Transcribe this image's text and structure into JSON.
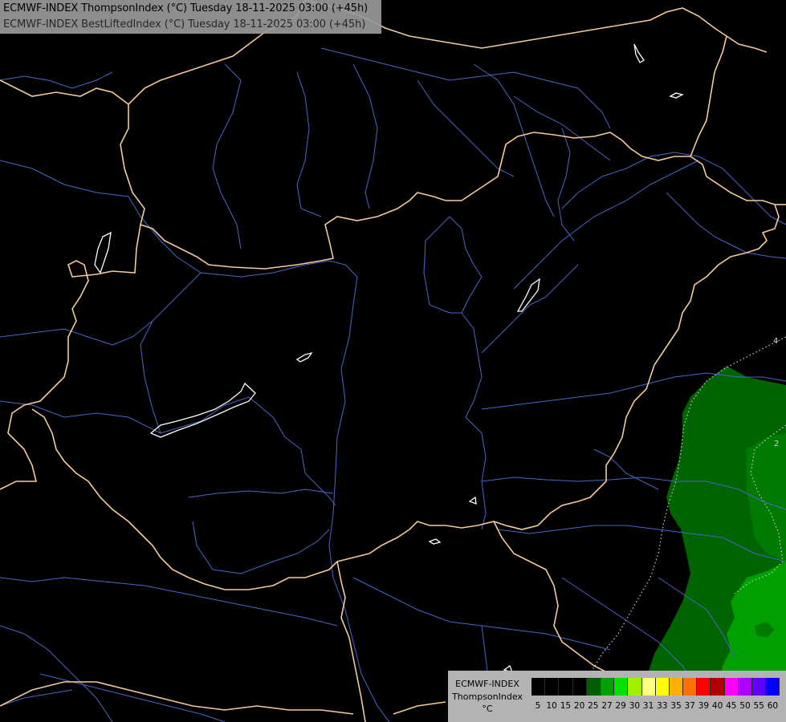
{
  "header": {
    "line1": "ECMWF-INDEX ThompsonIndex (°C) Tuesday 18-11-2025 03:00 (+45h)",
    "line2": "ECMWF-INDEX BestLiftedIndex (°C) Tuesday 18-11-2025 03:00 (+45h)"
  },
  "legend": {
    "label_line1": "ECMWF-INDEX",
    "label_line2": "ThompsonIndex",
    "unit": "°C",
    "tick_labels": [
      "5",
      "10",
      "15",
      "20",
      "25",
      "27",
      "29",
      "30",
      "31",
      "33",
      "35",
      "37",
      "39",
      "40",
      "45",
      "50",
      "55",
      "60"
    ],
    "colors": [
      "#000000",
      "#000000",
      "#000000",
      "#000000",
      "#005d00",
      "#00a000",
      "#00e000",
      "#a0f000",
      "#ffff80",
      "#ffff00",
      "#ffb000",
      "#ff7000",
      "#ff0000",
      "#b00000",
      "#ff00ff",
      "#b000ff",
      "#6000ff",
      "#0000ff"
    ]
  },
  "map_labels": {
    "contour_label_1": "4",
    "contour_label_2": "2"
  },
  "colors": {
    "border": "#f4c99c",
    "river": "#4a66c6",
    "lake": "#ffffff",
    "shade_dark": "#005d00",
    "shade_mid": "#00a000",
    "shade_dark2": "#006d00",
    "contour": "#c8c8c8"
  }
}
